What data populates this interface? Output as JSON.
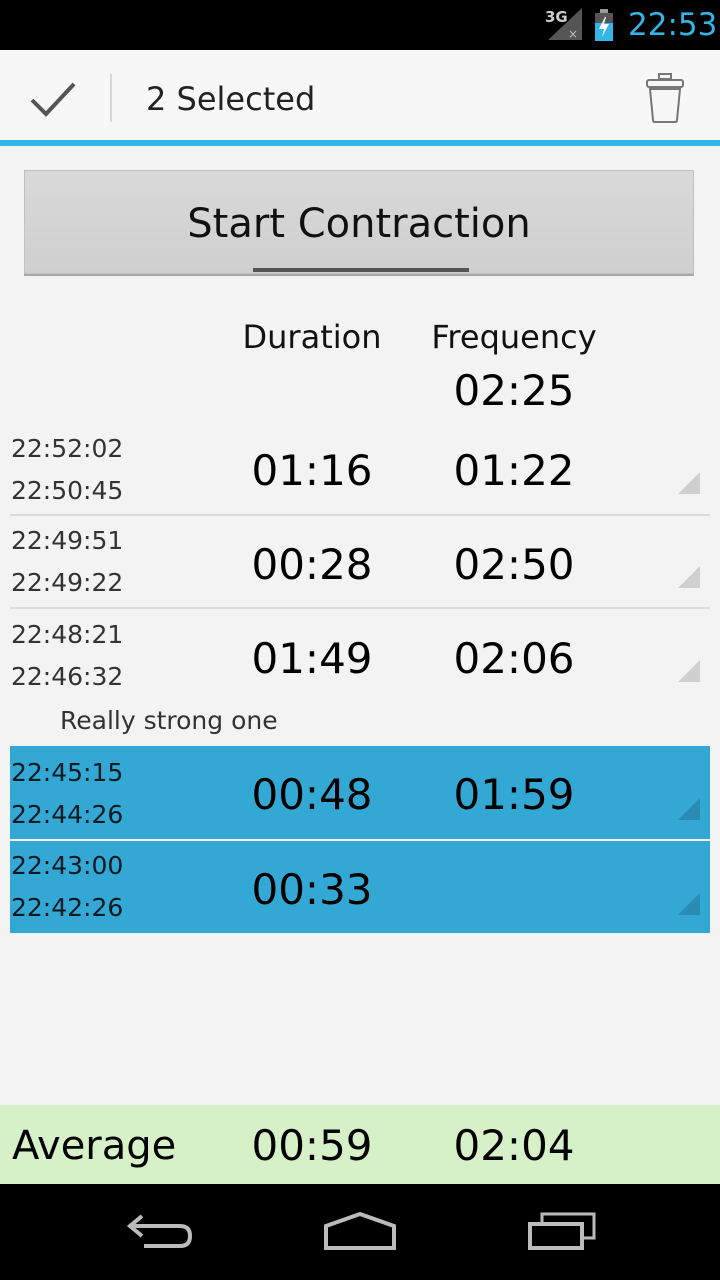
{
  "status_bar": {
    "network": "3G",
    "time": "22:53"
  },
  "action_bar": {
    "title": "2 Selected"
  },
  "start_button": {
    "label": "Start Contraction"
  },
  "table": {
    "header_duration": "Duration",
    "header_frequency": "Frequency",
    "current_frequency": "02:25",
    "rows": [
      {
        "end": "22:52:02",
        "start": "22:50:45",
        "duration": "01:16",
        "frequency": "01:22",
        "selected": false
      },
      {
        "end": "22:49:51",
        "start": "22:49:22",
        "duration": "00:28",
        "frequency": "02:50",
        "selected": false
      },
      {
        "end": "22:48:21",
        "start": "22:46:32",
        "duration": "01:49",
        "frequency": "02:06",
        "selected": false,
        "note": "Really strong one"
      },
      {
        "end": "22:45:15",
        "start": "22:44:26",
        "duration": "00:48",
        "frequency": "01:59",
        "selected": true
      },
      {
        "end": "22:43:00",
        "start": "22:42:26",
        "duration": "00:33",
        "frequency": "",
        "selected": true
      }
    ]
  },
  "average": {
    "label": "Average",
    "duration": "00:59",
    "frequency": "02:04"
  },
  "colors": {
    "accent": "#33b5e5",
    "selected_row": "#33a8d5",
    "average_bg": "#d6f0c8"
  },
  "icons": {
    "done": "check-icon",
    "delete": "trash-icon",
    "back": "back-icon",
    "home": "home-icon",
    "recents": "recents-icon"
  }
}
